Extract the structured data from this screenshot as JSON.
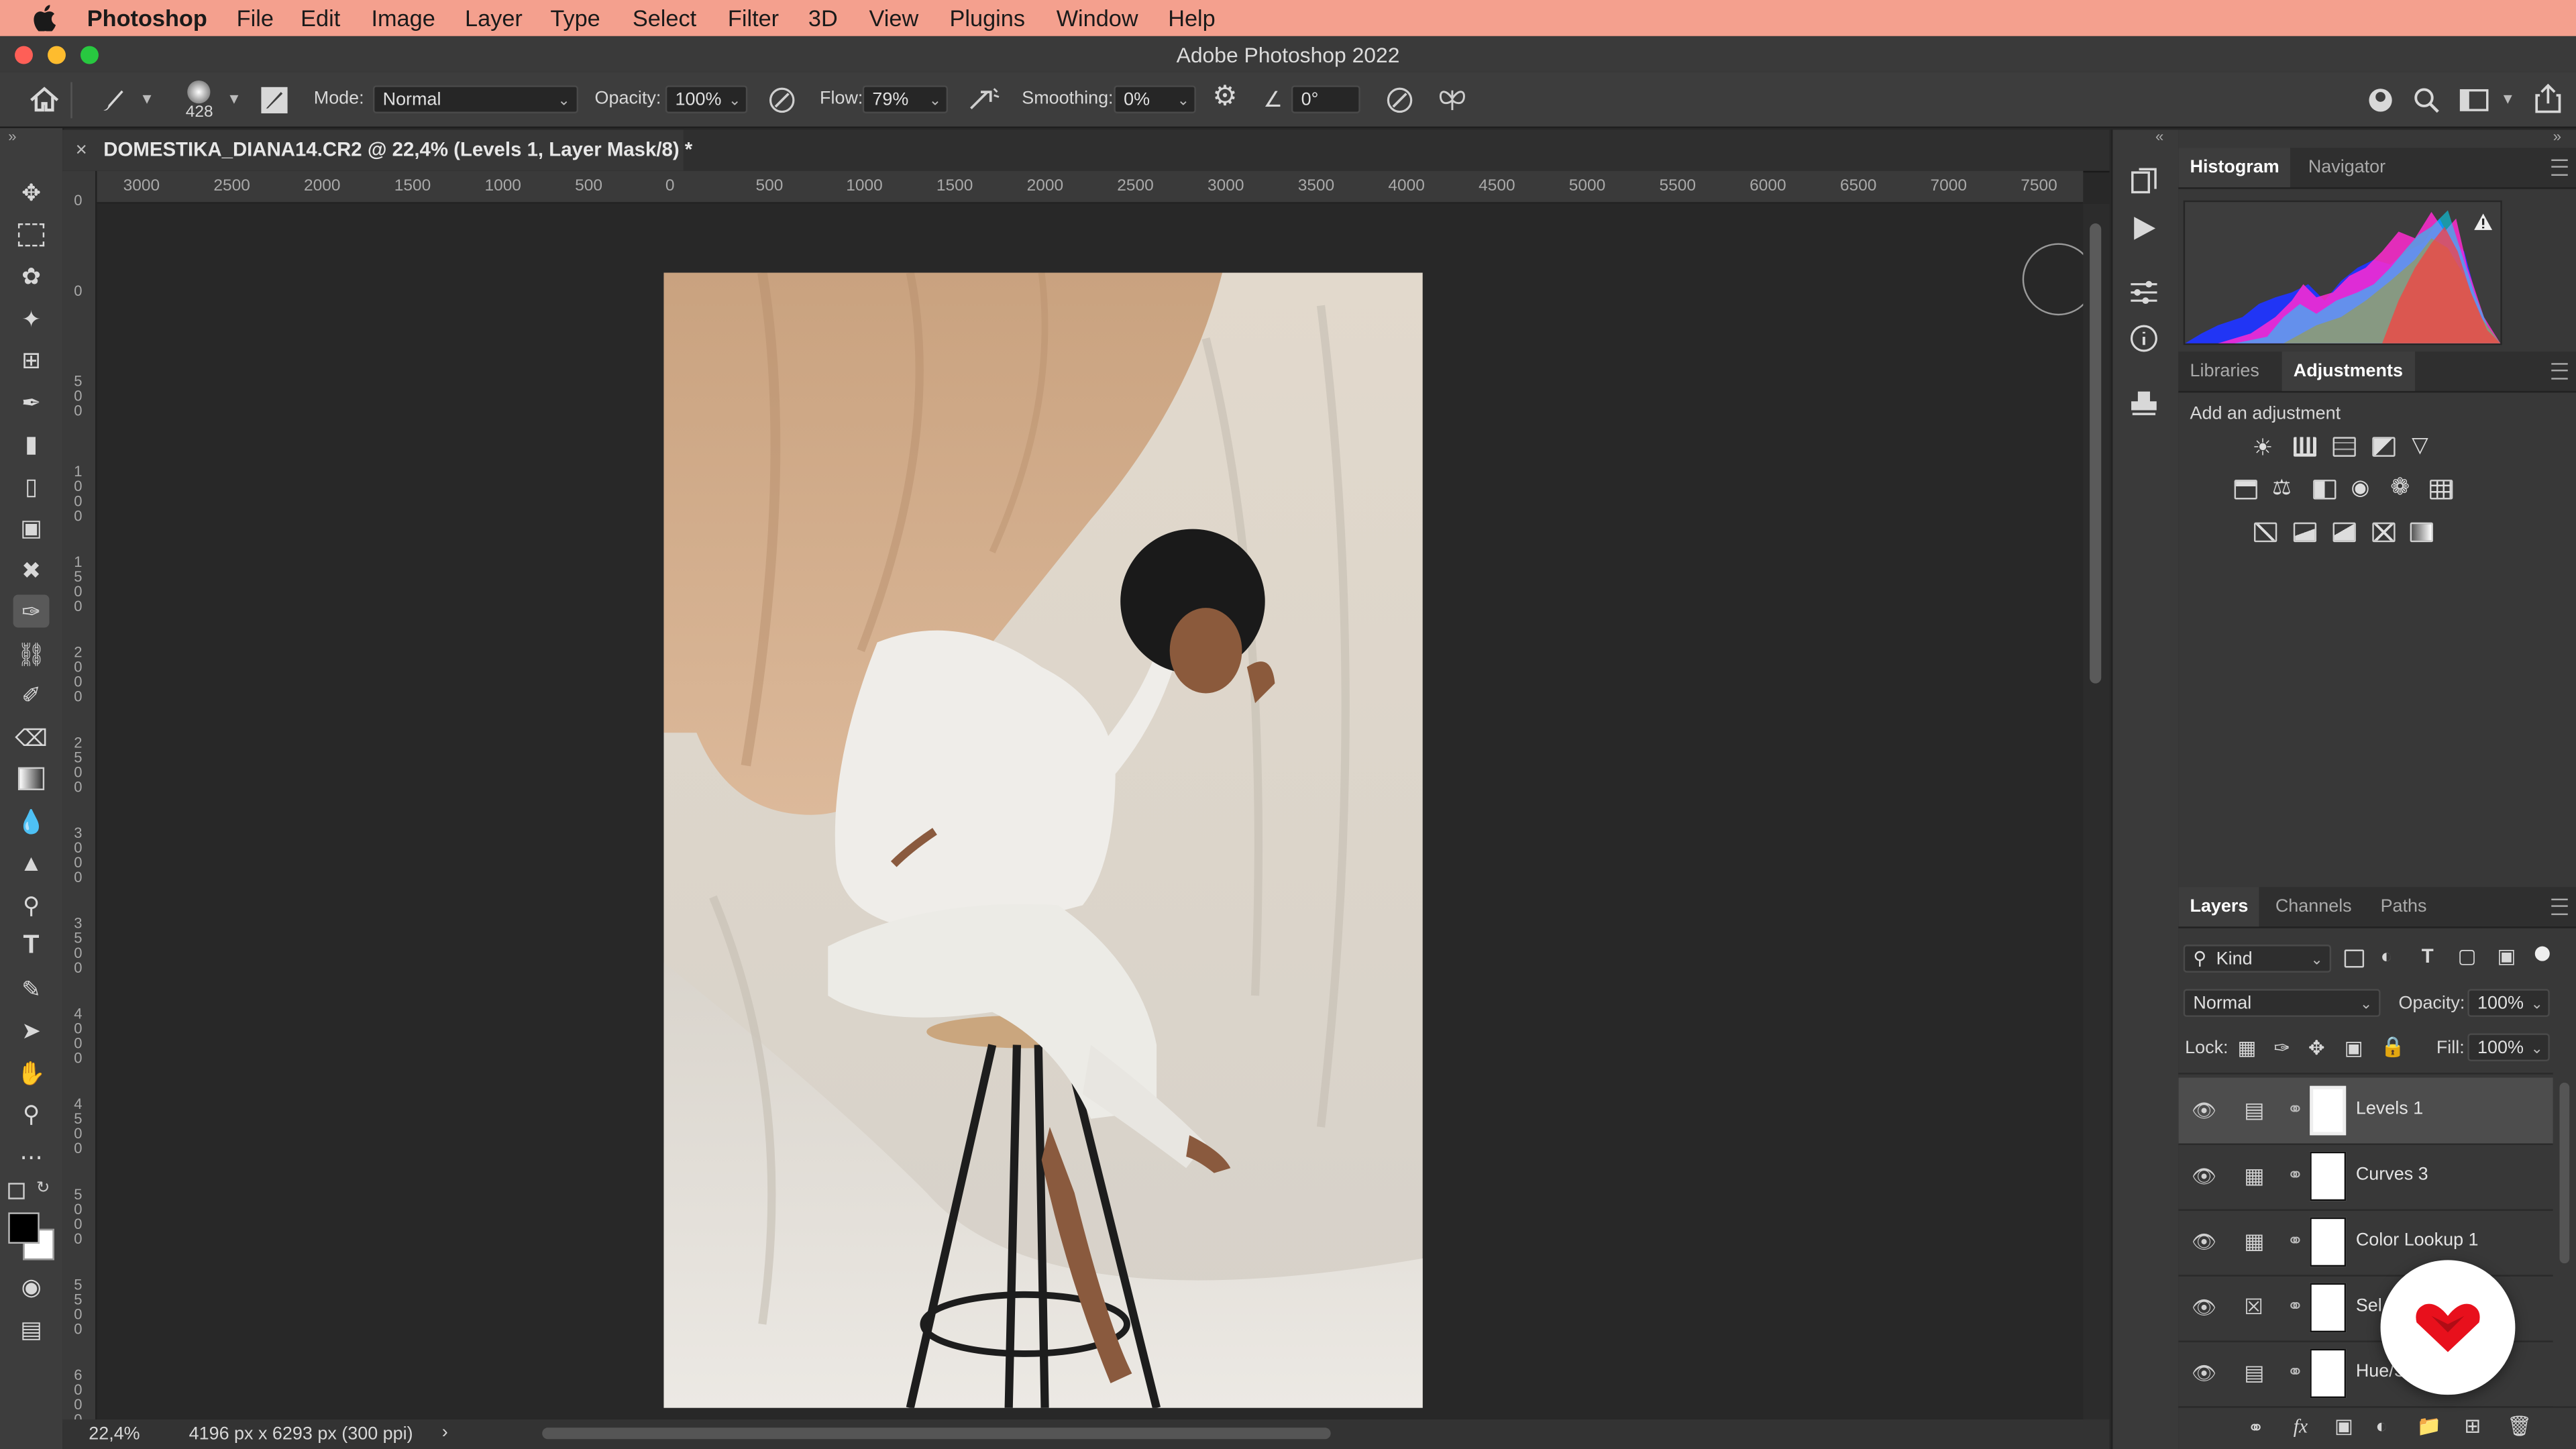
{
  "menubar": {
    "app": "Photoshop",
    "items": [
      "File",
      "Edit",
      "Image",
      "Layer",
      "Type",
      "Select",
      "Filter",
      "3D",
      "View",
      "Plugins",
      "Window",
      "Help"
    ]
  },
  "window": {
    "title": "Adobe Photoshop 2022"
  },
  "options": {
    "brush_size": "428",
    "mode_label": "Mode:",
    "mode_value": "Normal",
    "opacity_label": "Opacity:",
    "opacity_value": "100%",
    "flow_label": "Flow:",
    "flow_value": "79%",
    "smoothing_label": "Smoothing:",
    "smoothing_value": "0%",
    "angle_value": "0°"
  },
  "document": {
    "tab_title": "DOMESTIKA_DIANA14.CR2 @ 22,4% (Levels 1, Layer Mask/8) *",
    "zoom": "22,4%",
    "info": "4196 px x 6293 px (300 ppi)"
  },
  "ruler": {
    "h_ticks": [
      "3000",
      "2500",
      "2000",
      "1500",
      "1000",
      "500",
      "0",
      "500",
      "1000",
      "1500",
      "2000",
      "2500",
      "3000",
      "3500",
      "4000",
      "4500",
      "5000",
      "5500",
      "6000",
      "6500",
      "7000",
      "7500"
    ],
    "v_ticks": [
      "0",
      "0",
      "500",
      "1000",
      "1500",
      "2000",
      "2500",
      "3000",
      "3500",
      "4000",
      "4500",
      "5000",
      "5500",
      "6000"
    ]
  },
  "panels": {
    "top_tabs": [
      "Histogram",
      "Navigator"
    ],
    "mid_tabs": [
      "Libraries",
      "Adjustments"
    ],
    "add_adjustment": "Add an adjustment",
    "layer_tabs": [
      "Layers",
      "Channels",
      "Paths"
    ],
    "kind_filter": "Kind",
    "blend_mode": "Normal",
    "opacity_label": "Opacity:",
    "opacity_value": "100%",
    "lock_label": "Lock:",
    "fill_label": "Fill:",
    "fill_value": "100%"
  },
  "layers": [
    {
      "name": "Levels 1",
      "selected": true,
      "icon": "levels-icon"
    },
    {
      "name": "Curves 3",
      "selected": false,
      "icon": "curves-icon"
    },
    {
      "name": "Color Lookup 1",
      "selected": false,
      "icon": "color-lookup-icon"
    },
    {
      "name": "Sel",
      "selected": false,
      "icon": "selective-color-icon"
    },
    {
      "name": "Hue/S",
      "selected": false,
      "icon": "hue-saturation-icon"
    }
  ],
  "colors": {
    "menubar": "#f4a08e",
    "panel_bg": "#383838",
    "canvas_bg": "#282828",
    "badge": "#e8101c"
  }
}
